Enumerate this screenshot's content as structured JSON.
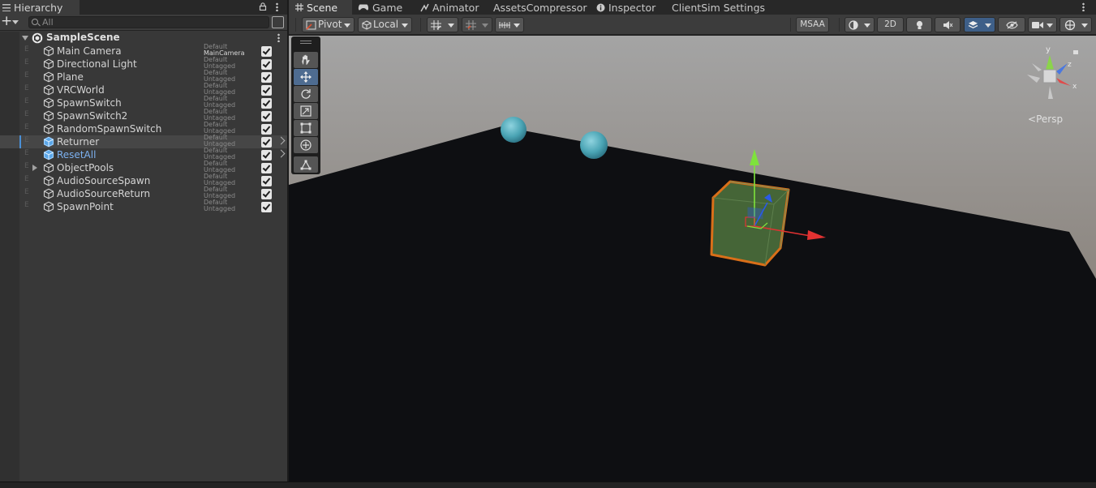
{
  "hierarchy": {
    "title": "Hierarchy",
    "search_placeholder": "All",
    "scene_name": "SampleScene",
    "items": [
      {
        "name": "Main Camera",
        "layer": "Default",
        "tag": "MainCamera"
      },
      {
        "name": "Directional Light",
        "layer": "Default",
        "tag": "Untagged"
      },
      {
        "name": "Plane",
        "layer": "Default",
        "tag": "Untagged"
      },
      {
        "name": "VRCWorld",
        "layer": "Default",
        "tag": "Untagged"
      },
      {
        "name": "SpawnSwitch",
        "layer": "Default",
        "tag": "Untagged"
      },
      {
        "name": "SpawnSwitch2",
        "layer": "Default",
        "tag": "Untagged"
      },
      {
        "name": "RandomSpawnSwitch",
        "layer": "Default",
        "tag": "Untagged"
      },
      {
        "name": "Returner",
        "layer": "Default",
        "tag": "Untagged"
      },
      {
        "name": "ResetAll",
        "layer": "Default",
        "tag": "Untagged"
      },
      {
        "name": "ObjectPools",
        "layer": "Default",
        "tag": "Untagged"
      },
      {
        "name": "AudioSourceSpawn",
        "layer": "Default",
        "tag": "Untagged"
      },
      {
        "name": "AudioSourceReturn",
        "layer": "Default",
        "tag": "Untagged"
      },
      {
        "name": "SpawnPoint",
        "layer": "Default",
        "tag": "Untagged"
      }
    ]
  },
  "tabs": {
    "scene": "Scene",
    "game": "Game",
    "animator": "Animator",
    "assets_compressor": "AssetsCompressor",
    "inspector": "Inspector",
    "clientsim": "ClientSim Settings"
  },
  "toolbar": {
    "pivot": "Pivot",
    "local": "Local",
    "msaa": "MSAA",
    "mode_2d": "2D"
  },
  "view": {
    "projection": "Persp",
    "gizmo_axes": {
      "x": "x",
      "y": "y",
      "z": "z"
    }
  },
  "colors": {
    "accent": "#4a8fd6",
    "selection_outline": "#f07a1a",
    "prefab_blue": "#7cb1f0"
  }
}
